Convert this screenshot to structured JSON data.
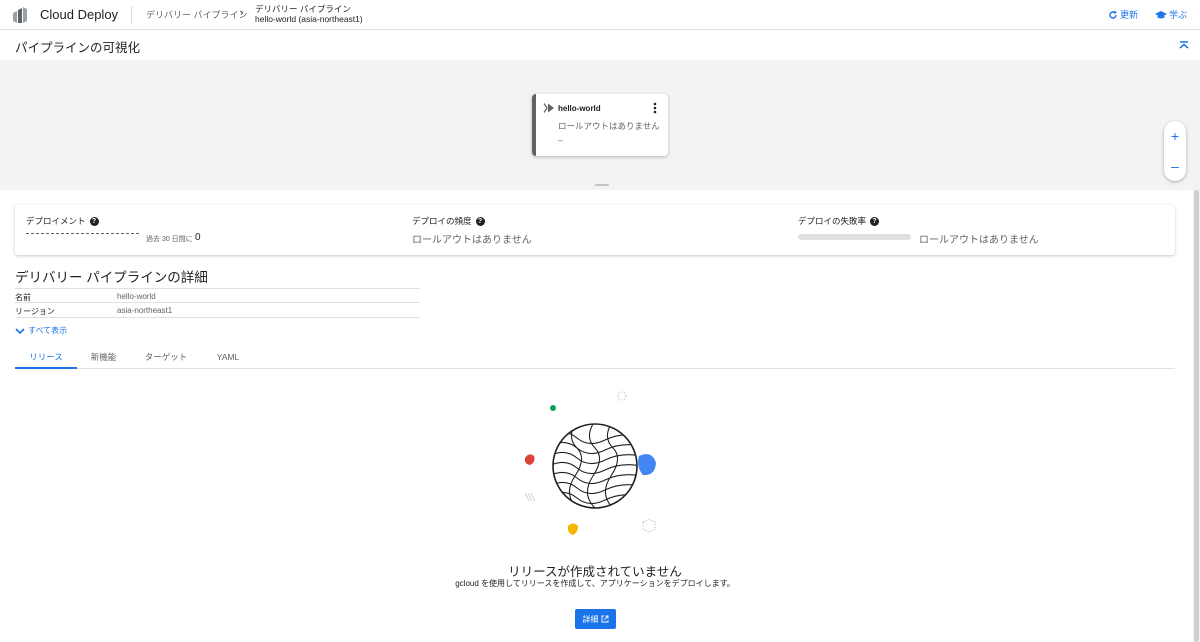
{
  "app": {
    "title": "Cloud Deploy"
  },
  "breadcrumb": {
    "parent": "デリバリー パイプライン",
    "current_line1": "デリバリー パイプライン",
    "current_line2": "hello-world (asia-northeast1)"
  },
  "toolbar": {
    "refresh_label": "更新",
    "learn_label": "学ぶ"
  },
  "visualization": {
    "title": "パイプラインの可視化",
    "node": {
      "name": "hello-world",
      "status": "ロールアウトはありません",
      "dash": "–"
    },
    "zoom_in": "+",
    "zoom_out": "–"
  },
  "metrics": {
    "deployments": {
      "title": "デプロイメント",
      "period_label": "過去 30 日間に",
      "count": "0"
    },
    "frequency": {
      "title": "デプロイの頻度",
      "value": "ロールアウトはありません"
    },
    "failure_rate": {
      "title": "デプロイの失敗率",
      "value": "ロールアウトはありません"
    }
  },
  "details": {
    "title": "デリバリー パイプラインの詳細",
    "rows": [
      {
        "key": "名前",
        "value": "hello-world"
      },
      {
        "key": "リージョン",
        "value": "asia-northeast1"
      }
    ],
    "show_all": "すべて表示"
  },
  "tabs": [
    {
      "label": "リリース",
      "active": true
    },
    {
      "label": "新機能",
      "active": false
    },
    {
      "label": "ターゲット",
      "active": false
    },
    {
      "label": "YAML",
      "active": false
    }
  ],
  "empty_state": {
    "title": "リリースが作成されていません",
    "subtitle": "gcloud を使用してリリースを作成して、アプリケーションをデプロイします。",
    "button_label": "詳細"
  },
  "colors": {
    "accent": "#1a73e8",
    "canvas_bg": "#f1f3f4",
    "red": "#db4437",
    "blue": "#4285f4",
    "yellow": "#f4b400",
    "green": "#0f9d58"
  }
}
